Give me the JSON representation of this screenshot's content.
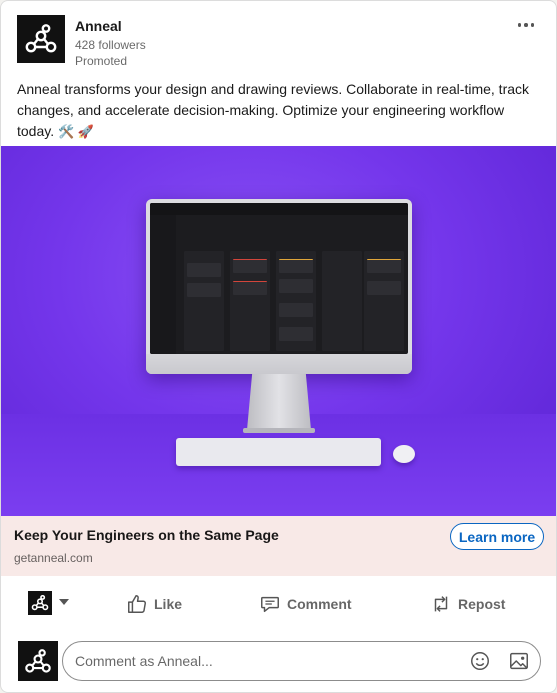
{
  "post": {
    "company": "Anneal",
    "followers": "428 followers",
    "promoted": "Promoted",
    "body": "Anneal transforms your design and drawing reviews. Collaborate in real-time, track changes, and accelerate decision-making. Optimize your engineering workflow today.",
    "body_emoji": "🛠️ 🚀"
  },
  "cta": {
    "title": "Keep Your Engineers on the Same Page",
    "domain": "getanneal.com",
    "button": "Learn more"
  },
  "actions": {
    "like": "Like",
    "comment": "Comment",
    "repost": "Repost"
  },
  "comment_box": {
    "placeholder": "Comment as Anneal..."
  },
  "colors": {
    "brand_blue": "#0a66c2",
    "hero_purple": "#7436eb",
    "cta_bg": "#f8e9e7",
    "logo_bg": "#111111"
  },
  "icons": [
    "anneal-logo-icon",
    "more-options-icon",
    "like-icon",
    "comment-icon",
    "repost-icon",
    "emoji-icon",
    "image-icon",
    "caret-down-icon"
  ]
}
